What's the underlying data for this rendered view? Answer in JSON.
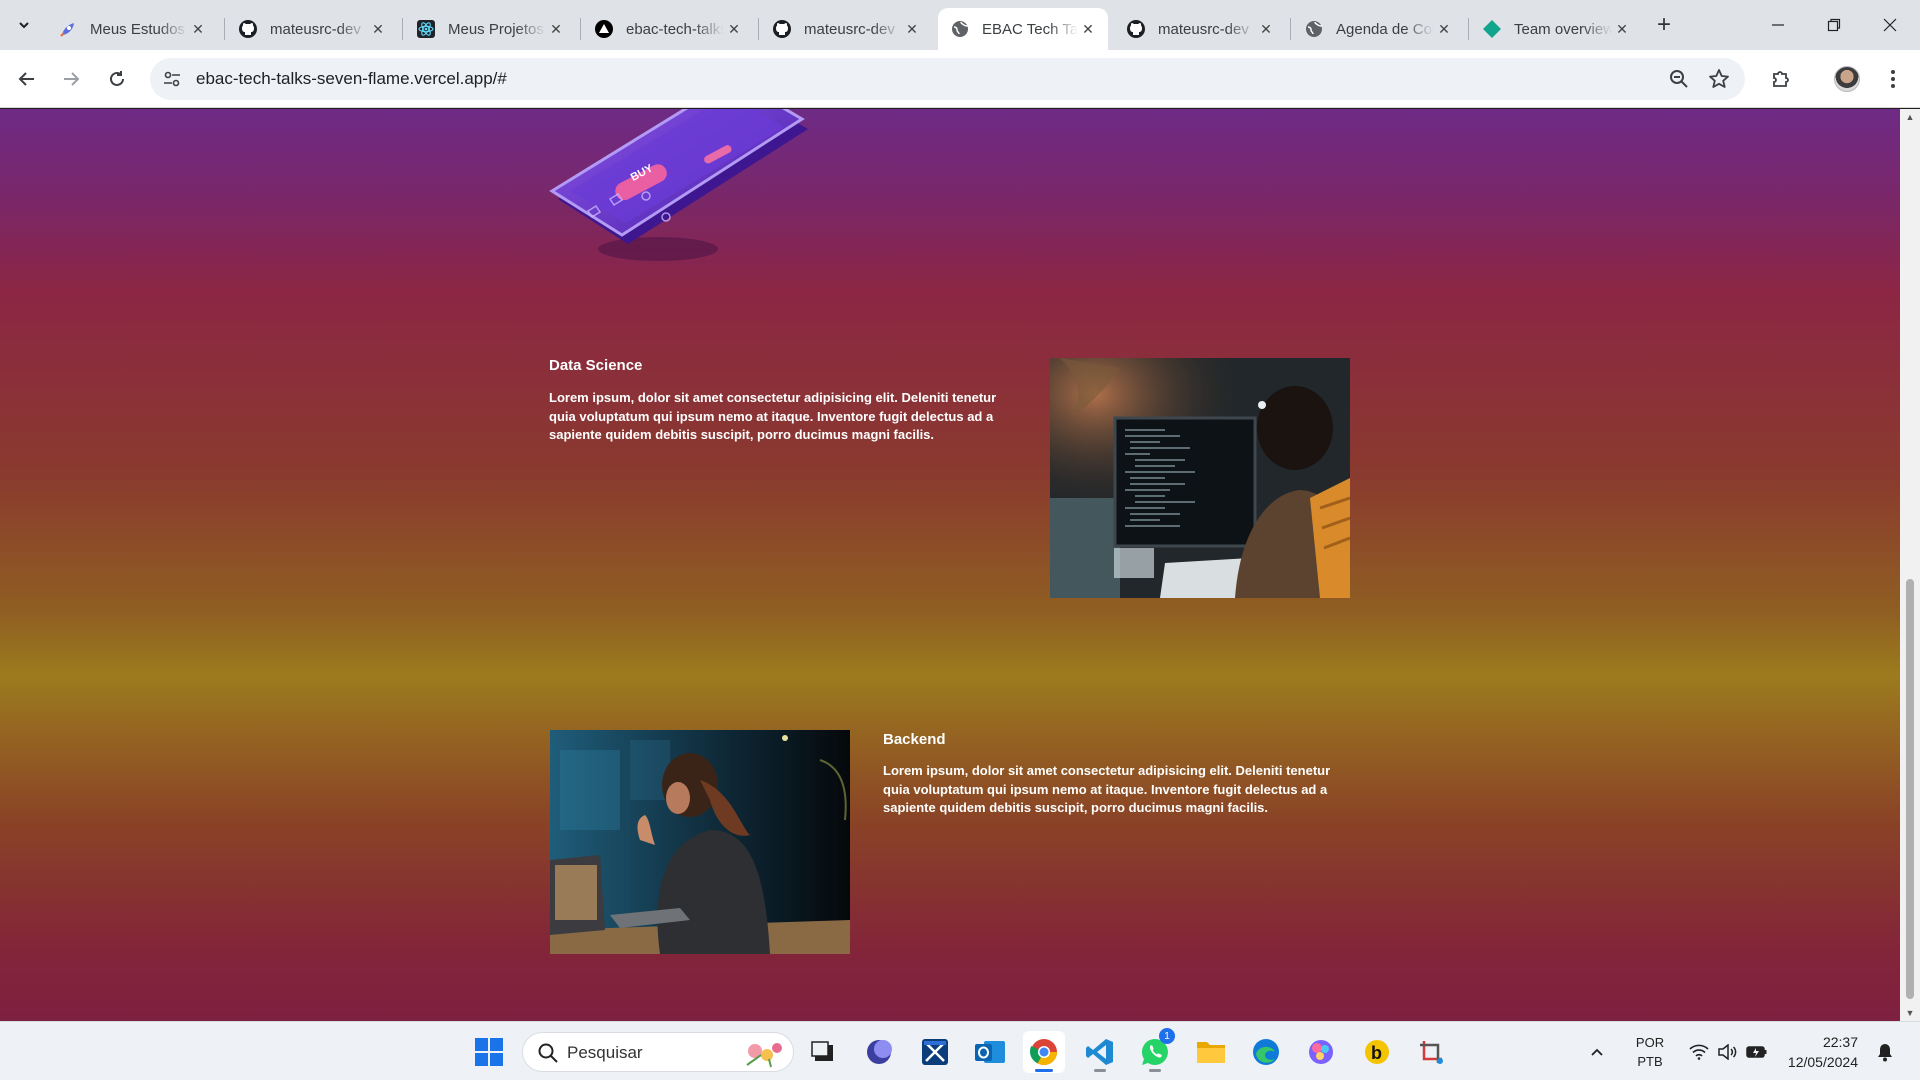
{
  "browser": {
    "tabs": [
      {
        "title": "Meus Estudos",
        "icon": "rocket-icon",
        "close": "✕",
        "active": false
      },
      {
        "title": "mateusrc-dev",
        "icon": "github-icon",
        "close": "✕",
        "active": false
      },
      {
        "title": "Meus Projetos",
        "icon": "react-icon",
        "close": "✕",
        "active": false
      },
      {
        "title": "ebac-tech-talks",
        "icon": "vercel-icon",
        "close": "✕",
        "active": false
      },
      {
        "title": "mateusrc-dev",
        "icon": "github-icon",
        "close": "✕",
        "active": false
      },
      {
        "title": "EBAC Tech Talks",
        "icon": "globe-icon",
        "close": "✕",
        "active": true
      },
      {
        "title": "mateusrc-dev",
        "icon": "github-icon",
        "close": "✕",
        "active": false
      },
      {
        "title": "Agenda de Contatos",
        "icon": "globe-icon",
        "close": "✕",
        "active": false
      },
      {
        "title": "Team overview",
        "icon": "diamond-icon",
        "close": "✕",
        "active": false
      }
    ],
    "new_tab_label": "+",
    "url": "ebac-tech-talks-seven-flame.vercel.app/#"
  },
  "page": {
    "phone_badge": "BUY",
    "sections": [
      {
        "title": "Data Science",
        "text": "Lorem ipsum, dolor sit amet consectetur adipisicing elit. Deleniti tenetur quia voluptatum qui ipsum nemo at itaque. Inventore fugit delectus ad a sapiente quidem debitis suscipit, porro ducimus magni facilis."
      },
      {
        "title": "Backend",
        "text": "Lorem ipsum, dolor sit amet consectetur adipisicing elit. Deleniti tenetur quia voluptatum qui ipsum nemo at itaque. Inventore fugit delectus ad a sapiente quidem debitis suscipit, porro ducimus magni facilis."
      }
    ]
  },
  "taskbar": {
    "search_placeholder": "Pesquisar",
    "whatsapp_badge": "1",
    "language_line1": "POR",
    "language_line2": "PTB",
    "time": "22:37",
    "date": "12/05/2024"
  },
  "colors": {
    "tabbar_bg": "#dfe3e8",
    "accent_blue": "#1f6feb",
    "page_gradient_top": "#6e2a86",
    "page_gradient_mid": "#9c7b1e",
    "page_gradient_bottom": "#7e2040"
  }
}
